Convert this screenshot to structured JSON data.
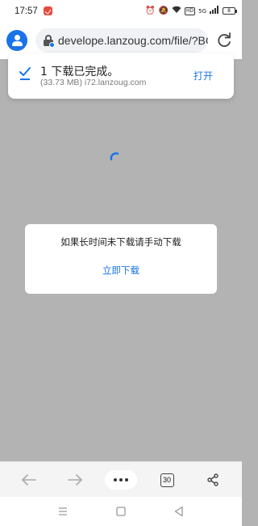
{
  "status_bar": {
    "time": "17:57",
    "network_tag": "HD",
    "signal_label": "5G",
    "battery": "8"
  },
  "browser": {
    "url": "develope.lanzoug.com/file/?BC"
  },
  "download_notice": {
    "title": "1 下载已完成。",
    "subtitle": "(33.73 MB) i72.lanzoug.com",
    "open_label": "打开"
  },
  "dialog": {
    "message": "如果长时间未下载请手动下载",
    "link_label": "立即下载"
  },
  "toolbar": {
    "tab_count": "30"
  },
  "colors": {
    "accent": "#1a73e8",
    "page_overlay": "#b3b3b3"
  }
}
